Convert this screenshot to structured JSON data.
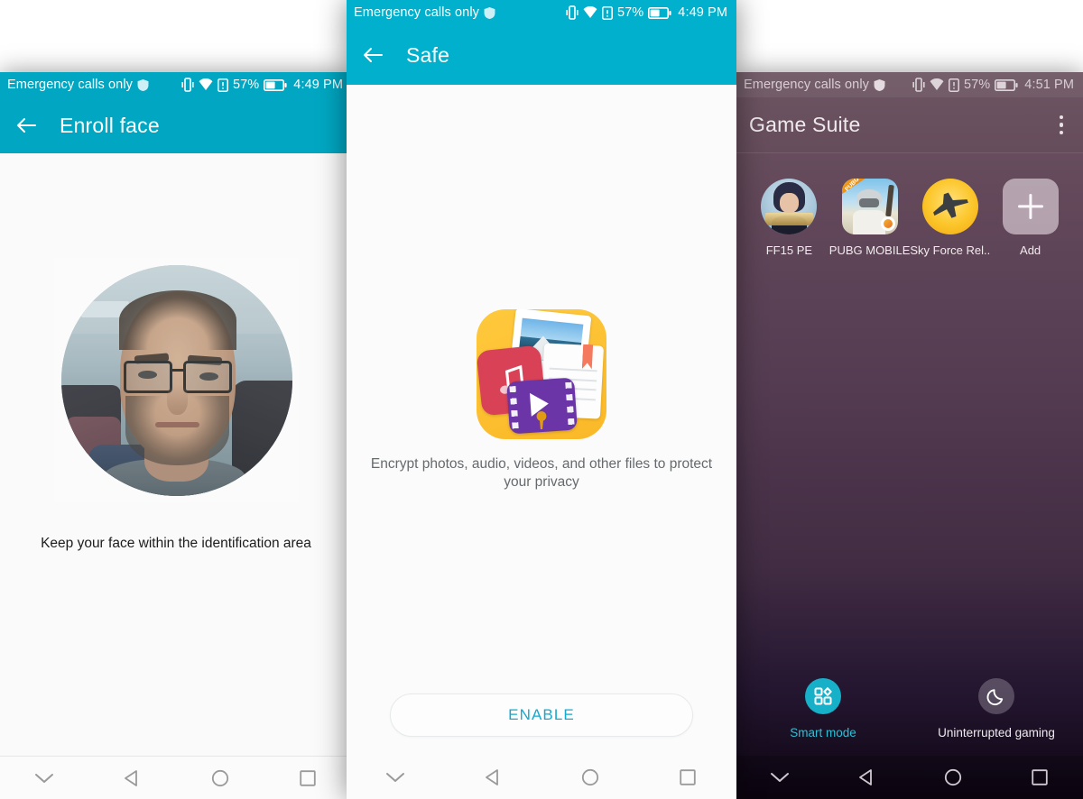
{
  "screens": {
    "left": {
      "status": {
        "carrier": "Emergency calls only",
        "battery_pct": "57%",
        "clock": "4:49 PM",
        "icons": [
          "vibrate-icon",
          "wifi-icon",
          "sim-card-icon",
          "battery-icon",
          "shield-icon"
        ]
      },
      "appbar": {
        "title": "Enroll face",
        "back_icon": "back-arrow-icon"
      },
      "hint": "Keep your face within the identification area",
      "photo_alt": "enrolled-face-preview"
    },
    "middle": {
      "status": {
        "carrier": "Emergency calls only",
        "battery_pct": "57%",
        "clock": "4:49 PM",
        "icons": [
          "vibrate-icon",
          "wifi-icon",
          "sim-card-icon",
          "battery-icon",
          "shield-icon"
        ]
      },
      "appbar": {
        "title": "Safe",
        "back_icon": "back-arrow-icon"
      },
      "description": "Encrypt photos, audio, videos, and other files to protect your privacy",
      "enable_label": "ENABLE",
      "app_icon": "safe-vault-icon"
    },
    "right": {
      "status": {
        "carrier": "Emergency calls only",
        "battery_pct": "57%",
        "clock": "4:51 PM",
        "icons": [
          "vibrate-icon",
          "wifi-icon",
          "sim-card-icon",
          "battery-icon",
          "shield-icon"
        ]
      },
      "appbar": {
        "title": "Game Suite",
        "overflow_icon": "kebab-menu-icon"
      },
      "games": [
        {
          "label": "FF15 PE",
          "icon": "final-fantasy-15-icon"
        },
        {
          "label": "PUBG MOBILE",
          "icon": "pubg-mobile-icon"
        },
        {
          "label": "Sky Force Rel..",
          "icon": "sky-force-reloaded-icon"
        },
        {
          "label": "Add",
          "icon": "plus-icon"
        }
      ],
      "modes": [
        {
          "label": "Smart mode",
          "icon": "grid-squares-icon",
          "active": true
        },
        {
          "label": "Uninterrupted gaming",
          "icon": "moon-icon",
          "active": false
        }
      ]
    }
  },
  "navbar": {
    "buttons": [
      {
        "name": "hide-navbar",
        "icon": "chevron-down-icon"
      },
      {
        "name": "back",
        "icon": "triangle-back-icon"
      },
      {
        "name": "home",
        "icon": "circle-home-icon"
      },
      {
        "name": "recents",
        "icon": "square-recents-icon"
      }
    ]
  },
  "colors": {
    "teal_left": "#01A7C2",
    "teal_mid": "#01B0CC",
    "enable_text": "#15A9CE",
    "smart_mode_accent": "#2EC0D6",
    "right_bg_top": "#6d5561",
    "right_bg_bottom": "#0d0512"
  }
}
